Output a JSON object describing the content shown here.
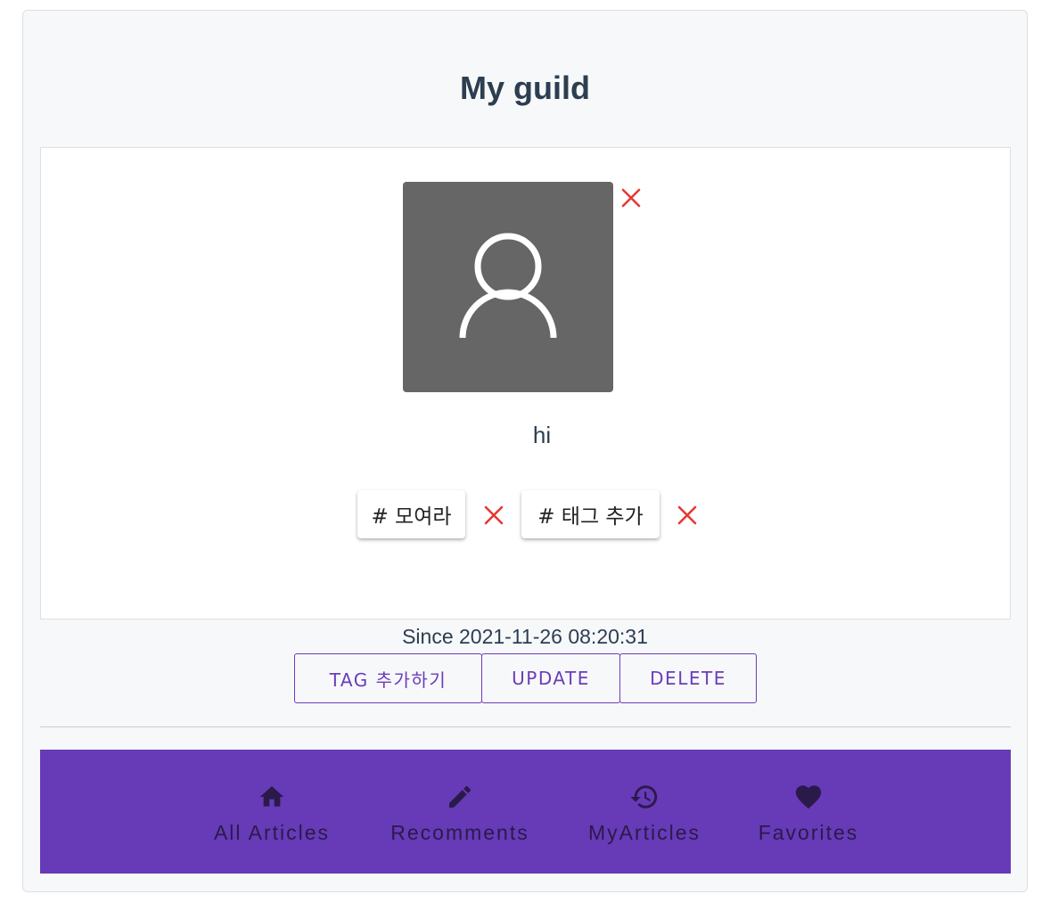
{
  "page": {
    "title": "My guild"
  },
  "profile": {
    "greeting": "hi",
    "tags": [
      {
        "label": "# 모여라"
      },
      {
        "label": "# 태그 추가"
      }
    ],
    "since": "Since 2021-11-26 08:20:31"
  },
  "actions": {
    "add_tag": "TAG 추가하기",
    "update": "UPDATE",
    "delete": "DELETE"
  },
  "bottom_nav": {
    "items": [
      {
        "label": "All Articles",
        "icon": "home-icon"
      },
      {
        "label": "Recomments",
        "icon": "pencil-icon"
      },
      {
        "label": "MyArticles",
        "icon": "history-icon"
      },
      {
        "label": "Favorites",
        "icon": "heart-icon"
      }
    ]
  },
  "colors": {
    "accent": "#673ab7",
    "danger": "#e53935",
    "avatar_bg": "#666666",
    "heading": "#2c3e50"
  }
}
